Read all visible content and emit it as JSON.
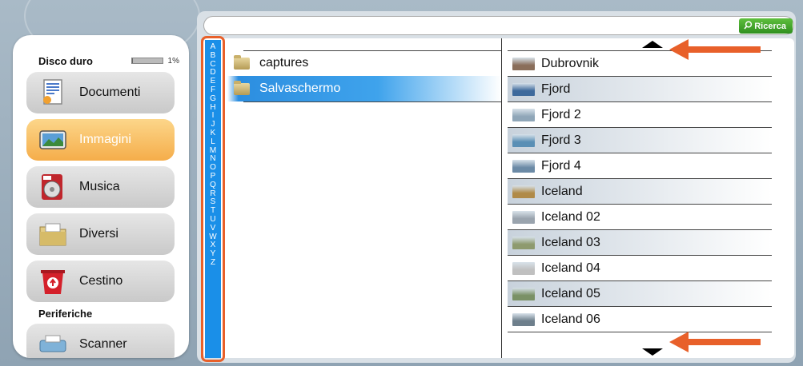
{
  "sidebar": {
    "disk_label": "Disco duro",
    "disk_percent": "1%",
    "disk_usage_fraction": 0.01,
    "categories": [
      {
        "label": "Documenti",
        "icon": "documents-icon",
        "active": false
      },
      {
        "label": "Immagini",
        "icon": "images-icon",
        "active": true
      },
      {
        "label": "Musica",
        "icon": "music-icon",
        "active": false
      },
      {
        "label": "Diversi",
        "icon": "folder-icon",
        "active": false
      },
      {
        "label": "Cestino",
        "icon": "trash-icon",
        "active": false
      }
    ],
    "peripherals_label": "Periferiche",
    "peripherals": [
      {
        "label": "Scanner",
        "icon": "scanner-icon"
      }
    ]
  },
  "search": {
    "value": "",
    "button_label": "Ricerca",
    "button_icon": "search-icon"
  },
  "alphabet": [
    "A",
    "B",
    "C",
    "D",
    "E",
    "F",
    "G",
    "H",
    "I",
    "J",
    "K",
    "L",
    "M",
    "N",
    "O",
    "P",
    "Q",
    "R",
    "S",
    "T",
    "U",
    "V",
    "W",
    "X",
    "Y",
    "Z"
  ],
  "folders": [
    {
      "name": "captures",
      "selected": false
    },
    {
      "name": "Salvaschermo",
      "selected": true
    }
  ],
  "files": [
    {
      "name": "Dubrovnik",
      "thumb": "#8a6e5a"
    },
    {
      "name": "Fjord",
      "thumb": "#3e6a9c"
    },
    {
      "name": "Fjord 2",
      "thumb": "#8fa6b8"
    },
    {
      "name": "Fjord 3",
      "thumb": "#5a8fb5"
    },
    {
      "name": "Fjord 4",
      "thumb": "#6b8aa6"
    },
    {
      "name": "Iceland",
      "thumb": "#b08a48"
    },
    {
      "name": "Iceland 02",
      "thumb": "#9aa4ae"
    },
    {
      "name": "Iceland 03",
      "thumb": "#8e9a6e"
    },
    {
      "name": "Iceland 04",
      "thumb": "#c0c0c0"
    },
    {
      "name": "Iceland 05",
      "thumb": "#7a9166"
    },
    {
      "name": "Iceland 06",
      "thumb": "#6e7f8c"
    }
  ],
  "colors": {
    "accent_orange": "#e8602a",
    "alphabet_blue": "#1a8fe8",
    "active_category": "#f5ad4a",
    "search_green": "#3fa02a"
  }
}
